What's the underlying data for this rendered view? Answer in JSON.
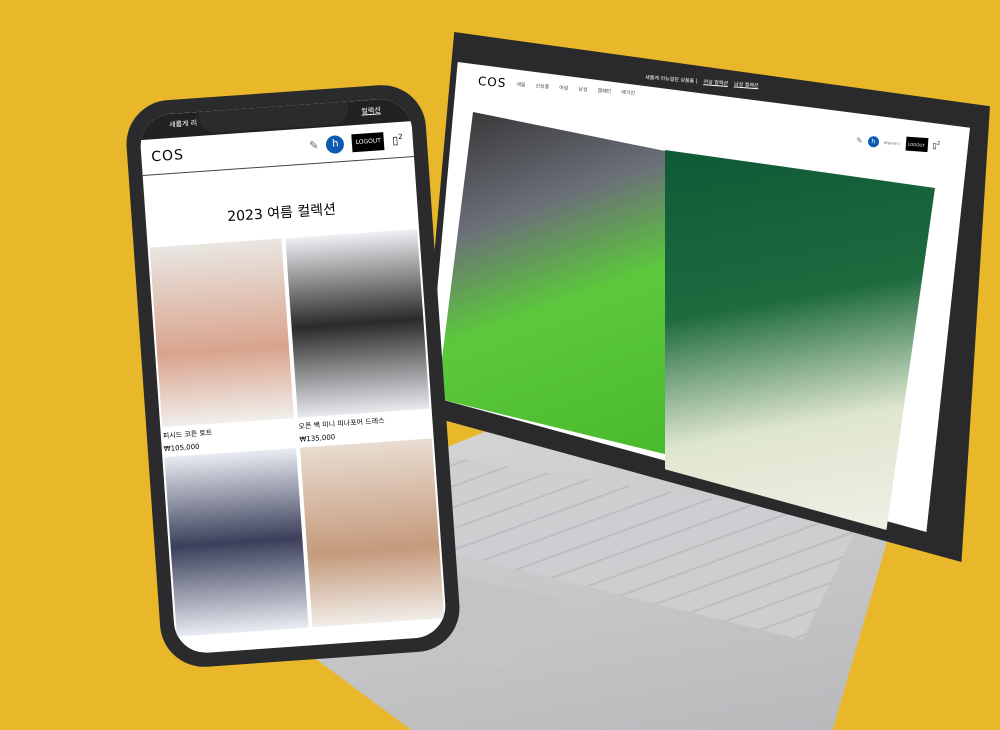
{
  "laptop": {
    "logo": "COS",
    "nav": [
      "세일",
      "신상품",
      "여성",
      "남성",
      "캠페인",
      "매거진"
    ],
    "banner_text": "새롭게 리뉴얼된 상품들 |",
    "banner_links": [
      "여성 컬렉션",
      "남성 컬렉션"
    ],
    "avatar": "h",
    "user": "hfamm /",
    "logout": "LOGOUT",
    "cart_count": "2"
  },
  "phone": {
    "banner_left": "새롭게 리",
    "banner_right": "컬렉션",
    "logo": "COS",
    "avatar": "h",
    "logout": "LOGOUT",
    "cart_count": "2",
    "title": "2023 여름 컬렉션",
    "products": [
      {
        "name": "피시드 코튼 토트",
        "price": "₩105,000"
      },
      {
        "name": "오픈 백 미니 피나포어 드레스",
        "price": "₩135,000"
      },
      {
        "name": "",
        "price": ""
      },
      {
        "name": "",
        "price": ""
      }
    ]
  }
}
